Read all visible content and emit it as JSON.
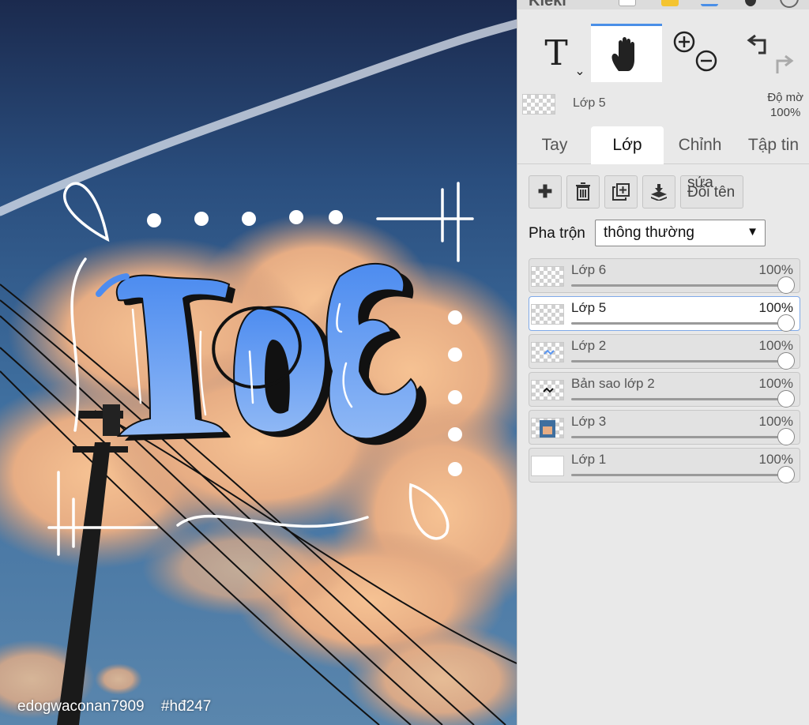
{
  "canvas": {
    "logo_letters": [
      "I",
      "o",
      "E"
    ],
    "watermark_user": "edogwaconan7909",
    "watermark_tag": "#hđ247"
  },
  "panel": {
    "app_name": "Kleki",
    "tools": [
      {
        "name": "text-tool",
        "label": "T"
      },
      {
        "name": "hand-tool",
        "icon": "hand-icon"
      },
      {
        "name": "zoom-tool",
        "icon": "zoom-in-out-icon"
      },
      {
        "name": "undo-redo-tool",
        "icon": "undo-redo-icon"
      }
    ],
    "active_layer": {
      "name": "Lớp 5",
      "opacity_label": "Độ mờ",
      "opacity_value": "100%"
    },
    "tabs": [
      "Tay",
      "Lớp",
      "Chỉnh sửa",
      "Tập tin"
    ],
    "tab_labels": {
      "tay": "Tay",
      "lop": "Lớp",
      "chinh": "Chỉnh",
      "tap_tin": "Tập tin"
    },
    "rename_button": {
      "overflow": "sửa",
      "label": "Đổi tên"
    },
    "blend": {
      "label": "Pha trộn",
      "value": "thông thường"
    },
    "layers": [
      {
        "name": "Lớp 6",
        "opacity": "100%",
        "selected": false,
        "thumb": "transparent"
      },
      {
        "name": "Lớp 5",
        "opacity": "100%",
        "selected": true,
        "thumb": "transparent"
      },
      {
        "name": "Lớp 2",
        "opacity": "100%",
        "selected": false,
        "thumb": "sketch-blue"
      },
      {
        "name": "Bản sao lớp 2",
        "opacity": "100%",
        "selected": false,
        "thumb": "sketch-black"
      },
      {
        "name": "Lớp 3",
        "opacity": "100%",
        "selected": false,
        "thumb": "photo"
      },
      {
        "name": "Lớp 1",
        "opacity": "100%",
        "selected": false,
        "thumb": "white"
      }
    ],
    "colors": {
      "accent": "#4a8fe7",
      "logo_blue": "#5b97f2"
    }
  }
}
